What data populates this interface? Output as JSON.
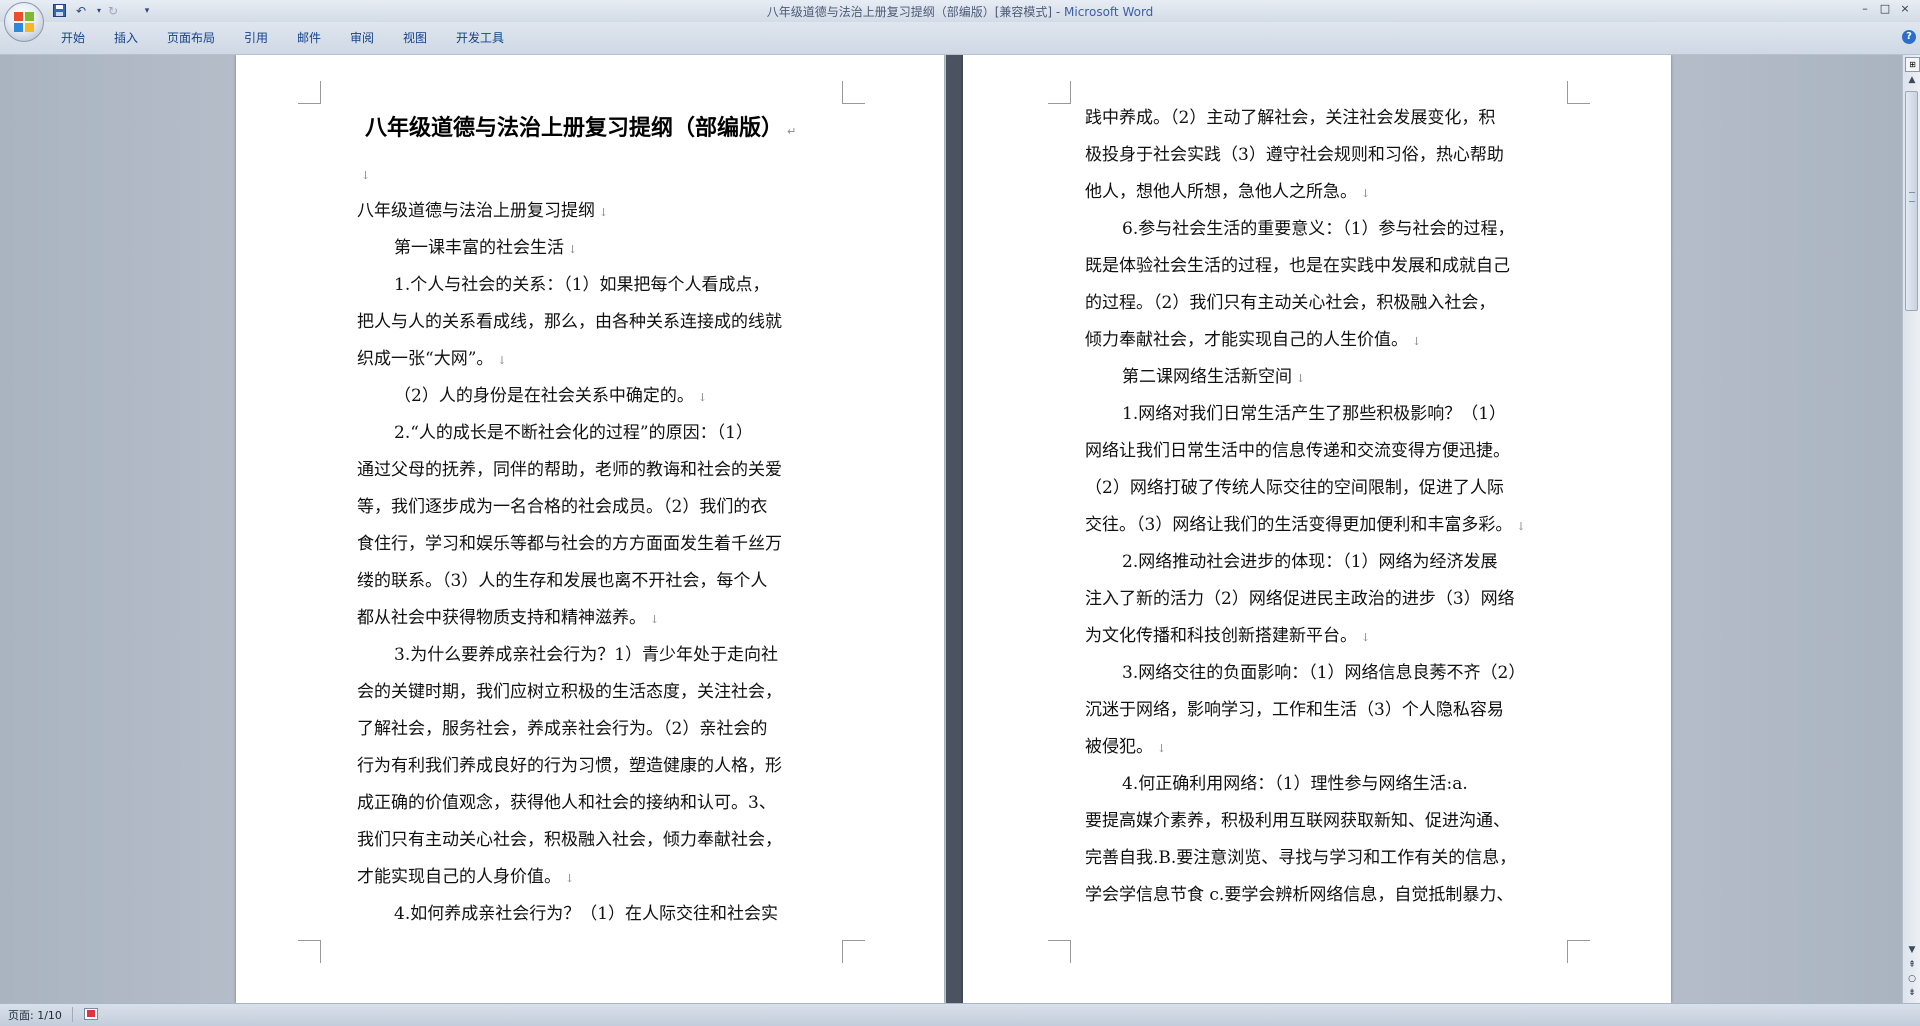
{
  "window": {
    "title_doc": "八年级道德与法治上册复习提纲（部编版）[兼容模式] - ",
    "title_app": "Microsoft Word",
    "controls": [
      "–",
      "□",
      "×"
    ]
  },
  "quick_access": {
    "icons": [
      "save-icon",
      "undo-icon",
      "redo-icon",
      "customize-icon"
    ]
  },
  "ribbon": {
    "tabs": [
      "开始",
      "插入",
      "页面布局",
      "引用",
      "邮件",
      "审阅",
      "视图",
      "开发工具"
    ]
  },
  "document": {
    "title": "八年级道德与法治上册复习提纲（部编版）",
    "left_lines": [
      "",
      "八年级道德与法治上册复习提纲",
      "第一课丰富的社会生活",
      "1.个人与社会的关系：（1）如果把每个人看成点，",
      "把人与人的关系看成线，那么，由各种关系连接成的线就",
      "织成一张“大网”。",
      "（2）人的身份是在社会关系中确定的。",
      "2.“人的成长是不断社会化的过程”的原因：（1）",
      "通过父母的抚养，同伴的帮助，老师的教诲和社会的关爱",
      "等，我们逐步成为一名合格的社会成员。（2）我们的衣",
      "食住行，学习和娱乐等都与社会的方方面面发生着千丝万",
      "缕的联系。（3）人的生存和发展也离不开社会，每个人",
      "都从社会中获得物质支持和精神滋养。",
      "3.为什么要养成亲社会行为？1）青少年处于走向社",
      "会的关键时期，我们应树立积极的生活态度，关注社会，",
      "了解社会，服务社会，养成亲社会行为。（2）亲社会的",
      "行为有利我们养成良好的行为习惯，塑造健康的人格，形",
      "成正确的价值观念，获得他人和社会的接纳和认可。3、",
      "我们只有主动关心社会，积极融入社会，倾力奉献社会，",
      "才能实现自己的人身价值。",
      "4.如何养成亲社会行为？（1）在人际交往和社会实"
    ],
    "right_lines": [
      "践中养成。（2）主动了解社会，关注社会发展变化，积",
      "极投身于社会实践（3）遵守社会规则和习俗，热心帮助",
      "他人，想他人所想，急他人之所急。",
      "6.参与社会生活的重要意义：（1）参与社会的过程，",
      "既是体验社会生活的过程，也是在实践中发展和成就自己",
      "的过程。（2）我们只有主动关心社会，积极融入社会，",
      "倾力奉献社会，才能实现自己的人生价值。",
      "第二课网络生活新空间",
      "1.网络对我们日常生活产生了那些积极影响？（1）",
      "网络让我们日常生活中的信息传递和交流变得方便迅捷。",
      "（2）网络打破了传统人际交往的空间限制，促进了人际",
      "交往。（3）网络让我们的生活变得更加便利和丰富多彩。",
      "2.网络推动社会进步的体现：（1）网络为经济发展",
      "注入了新的活力（2）网络促进民主政治的进步（3）网络",
      "为文化传播和科技创新搭建新平台。",
      "3.网络交往的负面影响：（1）网络信息良莠不齐（2）",
      "沉迷于网络，影响学习，工作和生活（3）个人隐私容易",
      "被侵犯。",
      "4.何正确利用网络：（1）理性参与网络生活:a.",
      "要提高媒介素养，积极利用互联网获取新知、促进沟通、",
      "完善自我.B.要注意浏览、寻找与学习和工作有关的信息，",
      "学会学信息节食 c.要学会辨析网络信息，自觉抵制暴力、"
    ],
    "para_mark": "↵",
    "line_break_mark": "↓"
  },
  "status": {
    "page_count": "页面: 1/10"
  }
}
